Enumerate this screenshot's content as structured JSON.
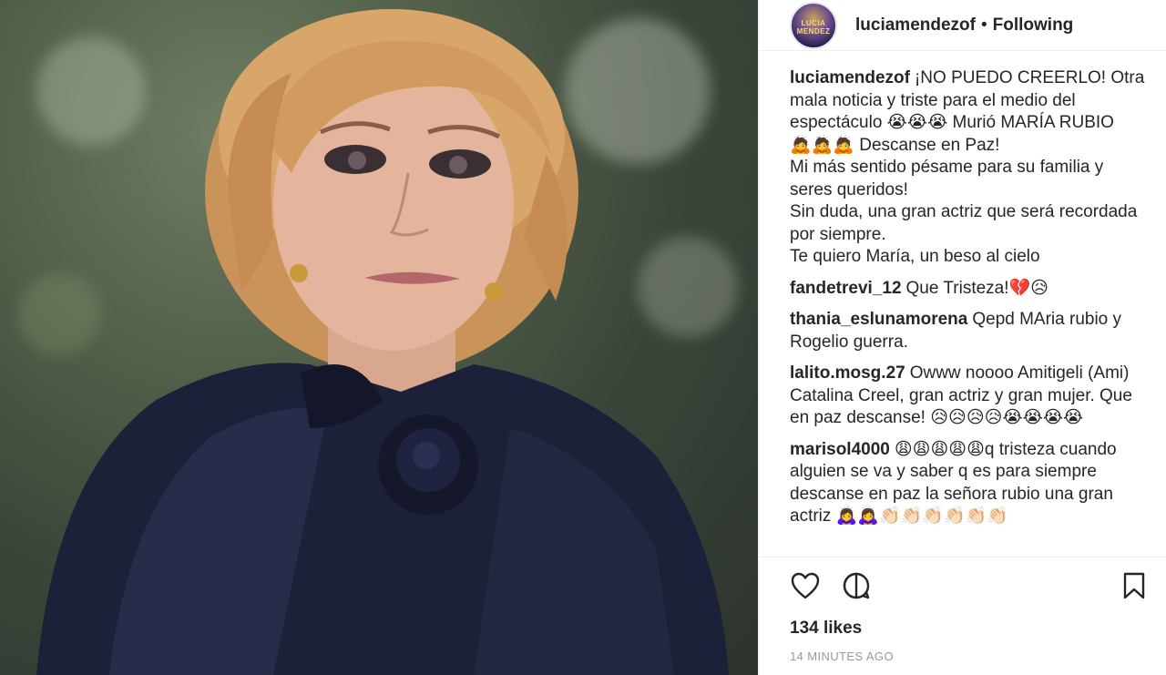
{
  "header": {
    "username": "luciamendezof",
    "separator": "•",
    "follow_status": "Following",
    "avatar_text": "LUCIA MENDEZ"
  },
  "caption": {
    "username": "luciamendezof",
    "lines": [
      "¡NO PUEDO CREERLO! Otra",
      "mala noticia y triste para el medio del",
      "espectáculo 😭😭😭 Murió MARÍA RUBIO",
      "🙇🙇🙇 Descanse en Paz!",
      "Mi más sentido pésame para su familia y",
      "seres queridos!",
      "Sin duda, una gran actriz que será recordada",
      "por siempre.",
      "Te quiero María, un beso al cielo"
    ]
  },
  "comments": [
    {
      "username": "fandetrevi_12",
      "text": "Que Tristeza!💔😥"
    },
    {
      "username": "thania_eslunamorena",
      "text": "Qepd MAria rubio y Rogelio guerra."
    },
    {
      "username": "lalito.mosg.27",
      "text": "Owww noooo Amitigeli (Ami) Catalina Creel, gran actriz y gran mujer. Que en paz descanse! 😥😥😥😥😭😭😭😭"
    },
    {
      "username": "marisol4000",
      "text": "😩😩😩😩😩q tristeza cuando alguien se va y saber q es para siempre descanse en paz la señora rubio una gran actriz 🙇‍♀️🙇‍♀️👏🏻👏🏻👏🏻👏🏻👏🏻👏🏻"
    }
  ],
  "actions": {
    "like_icon": "heart-icon",
    "comment_icon": "comment-icon",
    "save_icon": "bookmark-icon"
  },
  "likes": "134 likes",
  "timestamp": "14 MINUTES AGO",
  "colors": {
    "text": "#262626",
    "muted": "#999999",
    "border": "#efefef"
  }
}
